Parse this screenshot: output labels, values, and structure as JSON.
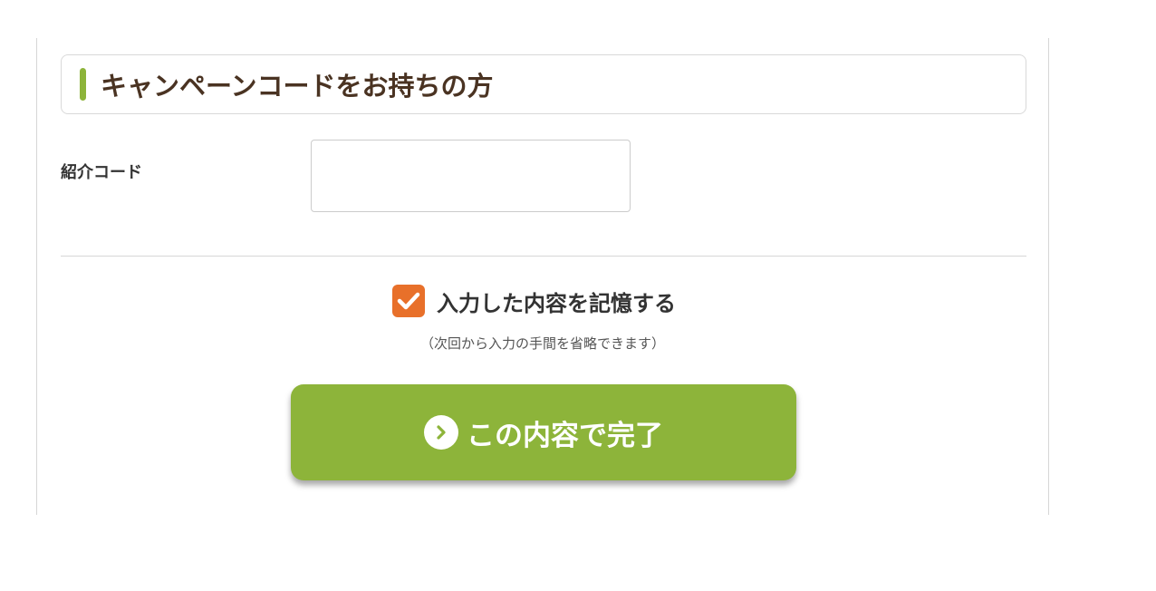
{
  "colors": {
    "accent_green": "#8db43a",
    "checkbox_orange": "#e8702a",
    "header_text": "#4a3322"
  },
  "campaign": {
    "section_title": "キャンペーンコードをお持ちの方",
    "referral_label": "紹介コード",
    "referral_value": "",
    "referral_placeholder": ""
  },
  "remember": {
    "checked": true,
    "label": "入力した内容を記憶する",
    "note": "（次回から入力の手間を省略できます）",
    "icon": "checkmark-icon"
  },
  "submit": {
    "label": "この内容で完了",
    "icon": "chevron-right-circle-icon"
  }
}
